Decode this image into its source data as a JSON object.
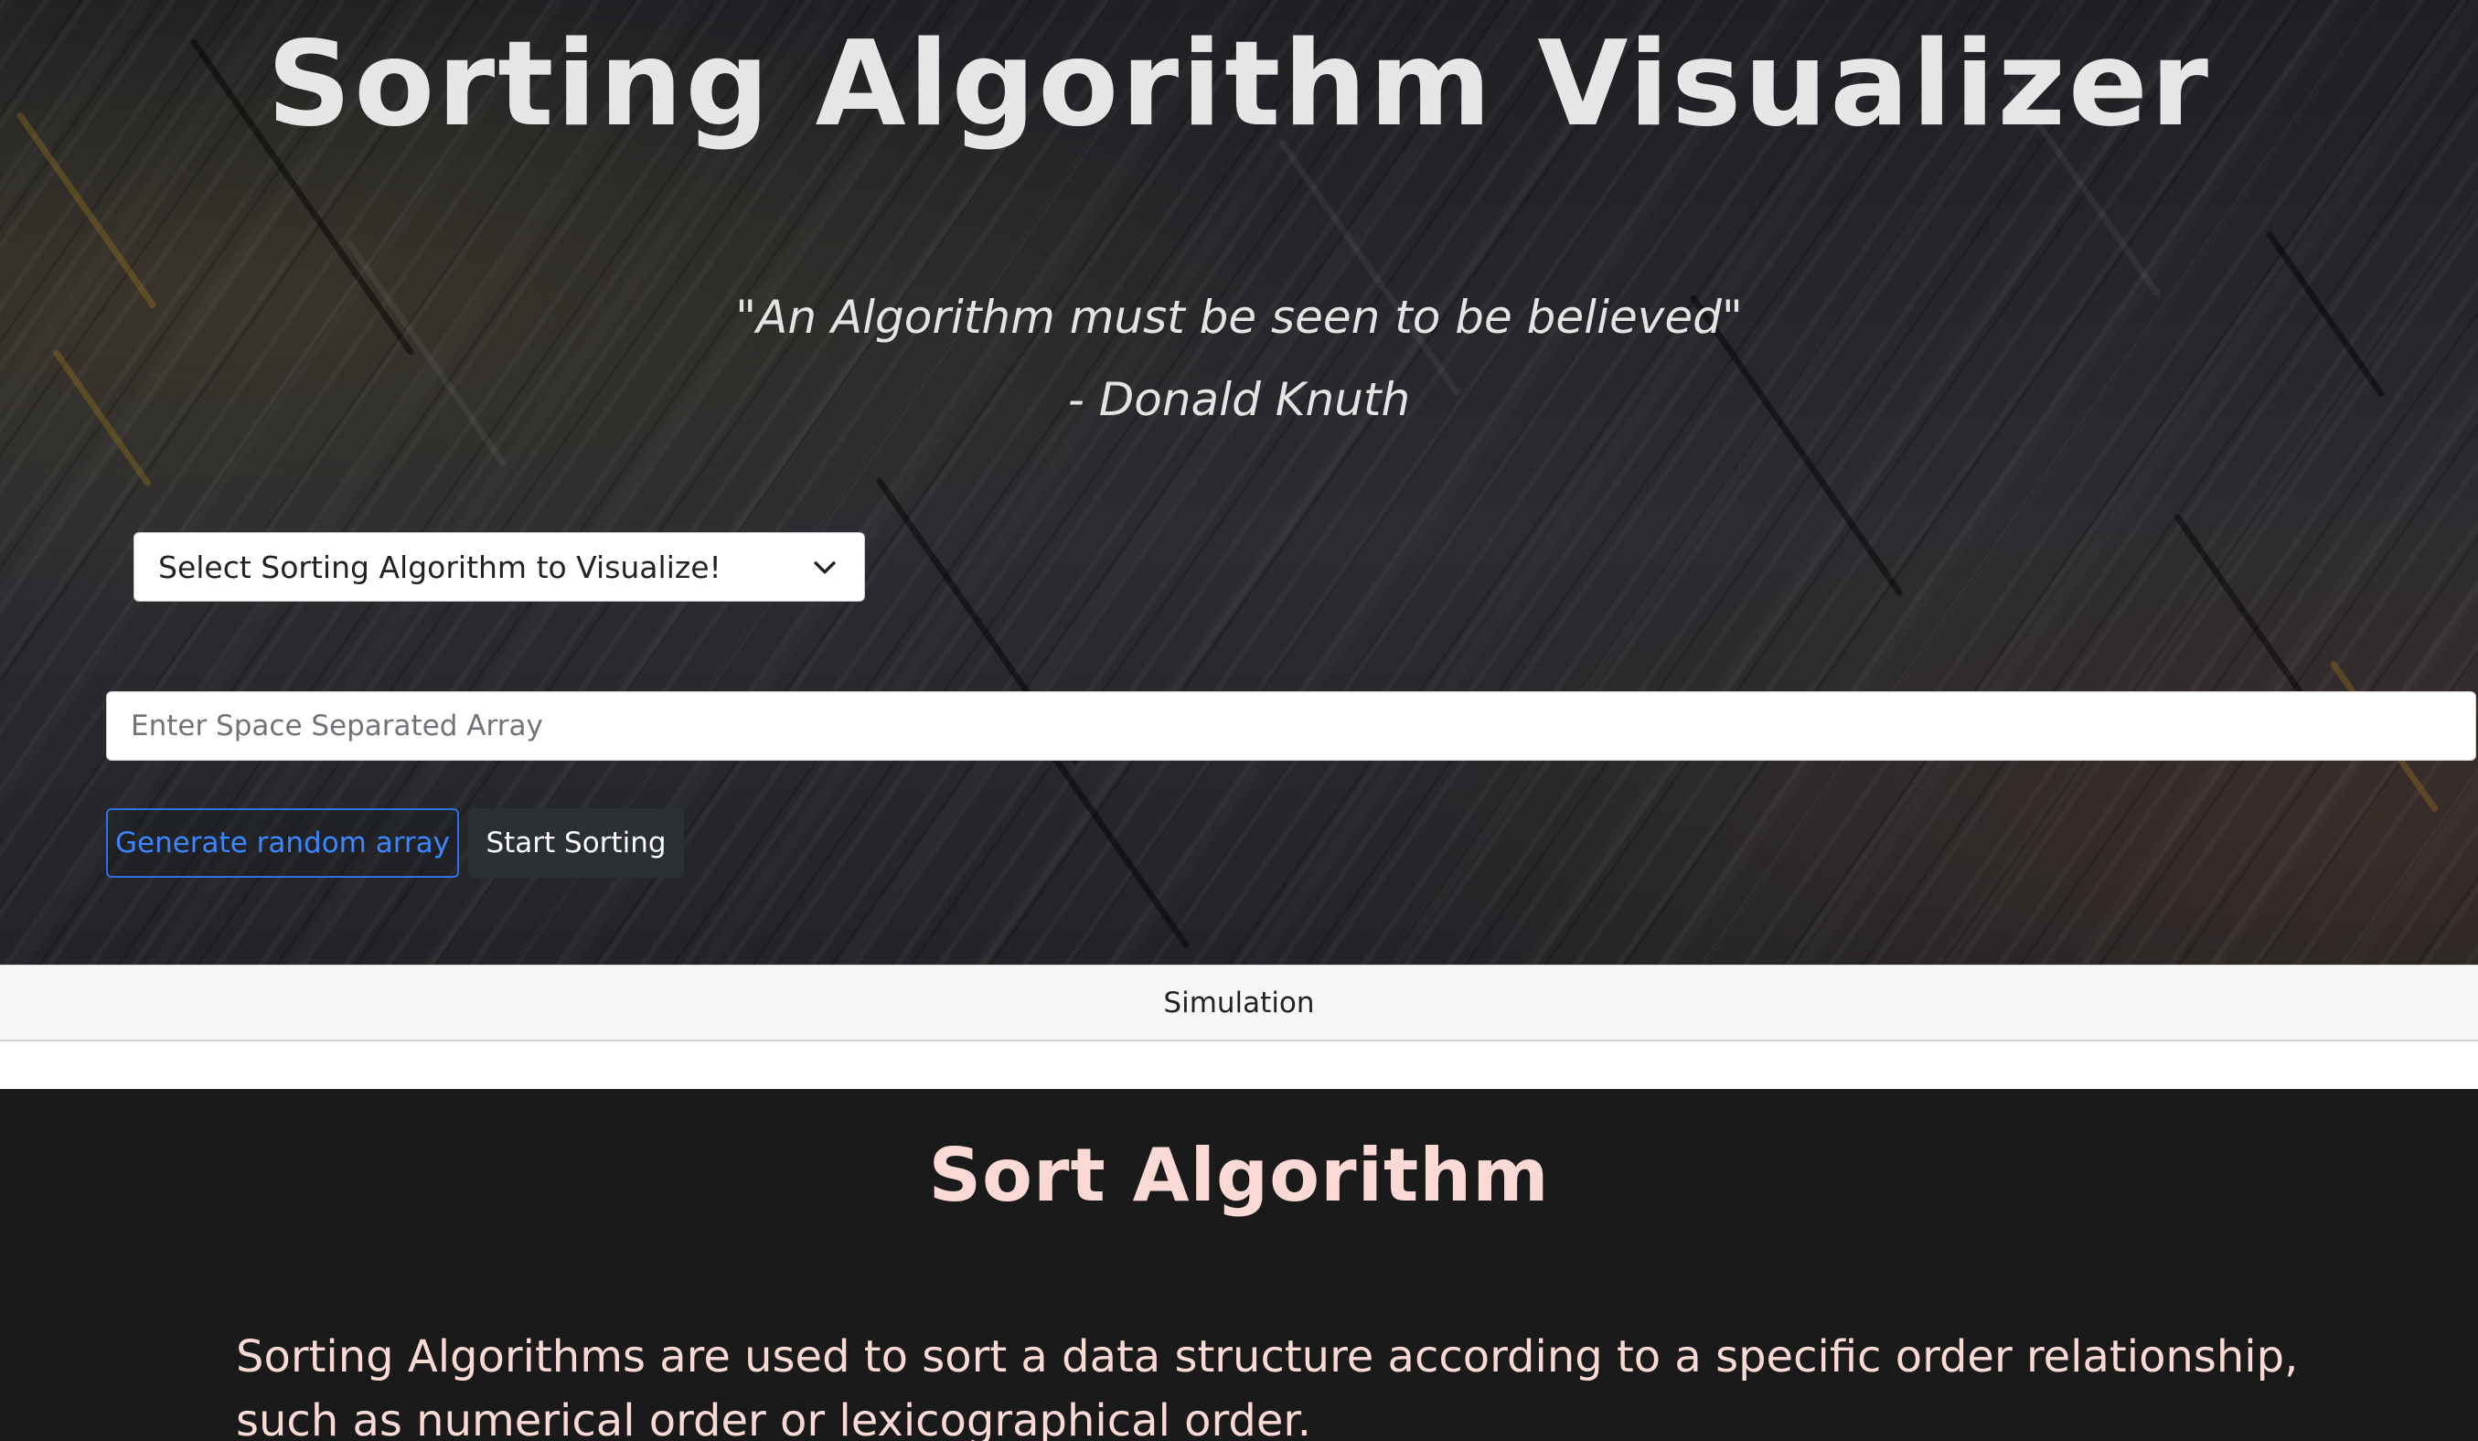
{
  "hero": {
    "title": "Sorting Algorithm Visualizer",
    "quote_line1": "\"An Algorithm must be seen to be believed\"",
    "quote_line2": "- Donald Knuth"
  },
  "controls": {
    "select_label": "Select Sorting Algorithm to Visualize!",
    "select_icon": "chevron-down-icon",
    "array_input_value": "",
    "array_input_placeholder": "Enter Space Separated Array",
    "random_button_label": "Generate random array",
    "start_button_label": "Start Sorting"
  },
  "simulation": {
    "label": "Simulation"
  },
  "info": {
    "title": "Sort Algorithm",
    "text": "Sorting Algorithms are used to sort a data structure according to a specific order relationship, such as numerical order or lexicographical order."
  },
  "colors": {
    "accent_blue": "#2f6fea",
    "info_text": "#fbdad6",
    "title_text": "#e7e6e6"
  }
}
